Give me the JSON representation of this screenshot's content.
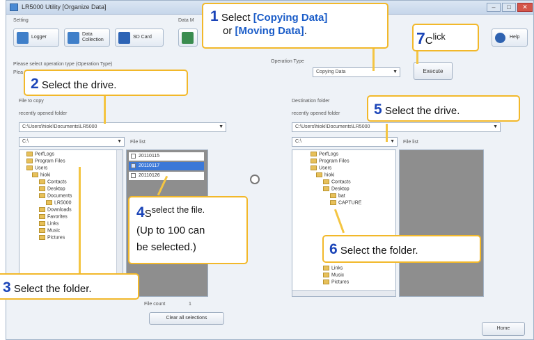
{
  "window": {
    "title": "LR5000 Utility [Organize Data]",
    "minimize": "–",
    "maximize": "□",
    "close": "✕"
  },
  "sections": {
    "setting": "Setting",
    "data_m": "Data M"
  },
  "toolbar": {
    "logger": "Logger",
    "data_collection_1": "Data",
    "data_collection_2": "Collection",
    "sd_card": "SD Card",
    "help": "Help"
  },
  "operation": {
    "prompt": "Please select operation type (Operation Type)",
    "prompt2": "Plea",
    "type_label": "Operation Type",
    "type_value": "Copying Data",
    "execute_button": "Execute"
  },
  "source": {
    "file_to_copy": "File to copy",
    "recent_label": "recently opened folder",
    "recent_path": "C:\\Users\\hioki\\Documents\\LR5000",
    "drive": "C:\\",
    "file_list_label": "File list",
    "tree": [
      "PerfLogs",
      "Program Files",
      "Users",
      "hioki",
      "Contacts",
      "Desktop",
      "Documents",
      "LR5000",
      "Downloads",
      "Favorites",
      "Links",
      "Music",
      "Pictures"
    ],
    "files": [
      "20110115",
      "20110117",
      "20110126"
    ],
    "file_count_label": "File count",
    "file_count": "1",
    "clear_button": "Clear all selections"
  },
  "destination": {
    "folder_label": "Destination folder",
    "recent_label": "recently opened folder",
    "recent_path": "C:\\Users\\hioki\\Documents\\LR5000",
    "drive": "C:\\",
    "file_list_label": "File list",
    "tree": [
      "PerfLogs",
      "Program Files",
      "Users",
      "hioki",
      "Contacts",
      "Desktop",
      "bat",
      "CAPTURE",
      "Links",
      "Music",
      "Pictures"
    ]
  },
  "home_button": "Home",
  "callouts": {
    "c1": {
      "num": "1",
      "t1": " Select ",
      "b1": "[Copying Data]",
      "t2": "or ",
      "b2": "[Moving Data]",
      "t3": "."
    },
    "c2": {
      "num": "2",
      "text": " Select the drive."
    },
    "c3": {
      "num": "3",
      "text": " Select the folder."
    },
    "c4": {
      "num": "4",
      "text": "select the file.",
      "line2": "(Up to 100 can",
      "line3": "be selected.)",
      "prefix": "S"
    },
    "c5": {
      "num": "5",
      "text": " Select the drive."
    },
    "c6": {
      "num": "6",
      "text": " Select the folder."
    },
    "c7": {
      "num": "7",
      "text": "lick",
      "prefix": "C"
    }
  },
  "colors": {
    "callout_border": "#f2b82a",
    "number": "#1a44b8",
    "highlight": "#1a5cc8"
  }
}
